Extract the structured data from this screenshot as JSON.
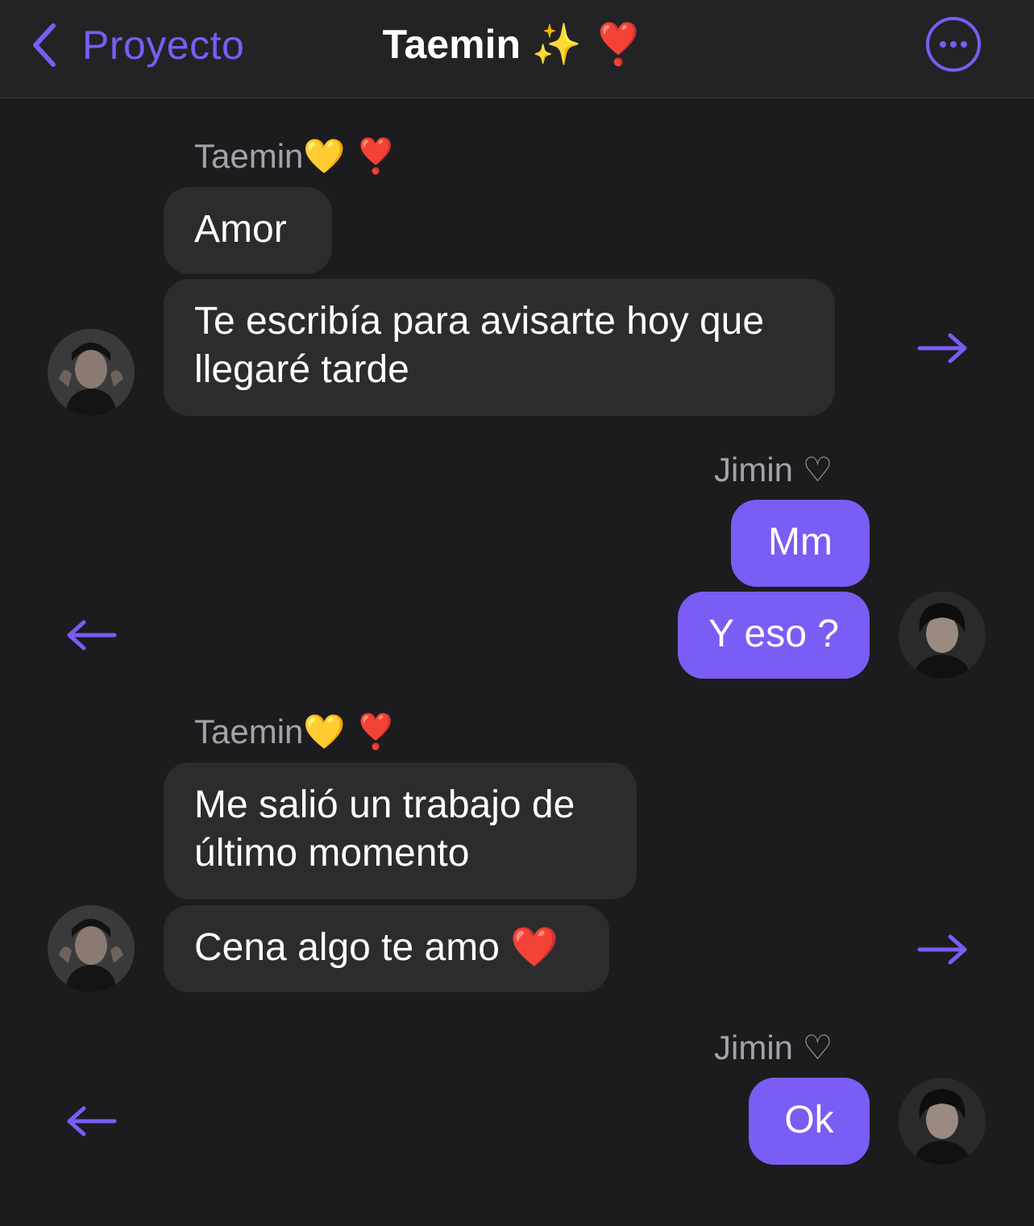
{
  "header": {
    "back_label": "Proyecto",
    "title": "Taemin ✨ ❣️"
  },
  "colors": {
    "accent": "#7b5cf5",
    "background": "#1c1c1e",
    "incoming_bubble": "#2c2c2e",
    "outgoing_bubble": "#7b5cf5",
    "sender_name": "#a3a3a8"
  },
  "messages": {
    "group1": {
      "sender": "Taemin💛 ❣️",
      "bubbles": [
        "Amor",
        "Te escribía para avisarte hoy que llegaré tarde"
      ]
    },
    "group2": {
      "sender": "Jimin ♡",
      "bubbles": [
        "Mm",
        "Y eso ?"
      ]
    },
    "group3": {
      "sender": "Taemin💛 ❣️",
      "bubbles": [
        "Me salió un trabajo de último momento",
        "Cena algo te amo ❤️"
      ]
    },
    "group4": {
      "sender": "Jimin ♡",
      "bubbles": [
        "Ok"
      ]
    }
  },
  "icons": {
    "back": "chevron-left-icon",
    "more": "ellipsis-circle-icon",
    "forward": "arrow-right-icon",
    "reply": "arrow-left-icon"
  }
}
